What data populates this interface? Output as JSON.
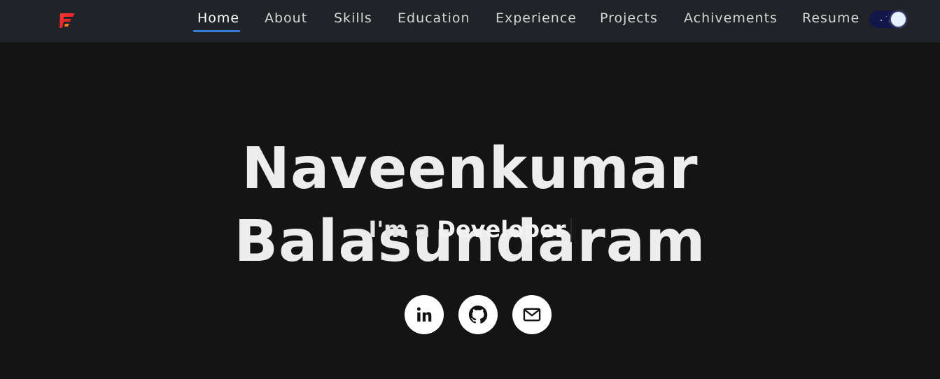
{
  "nav": {
    "logo_icon": "brand-logo-icon",
    "items": [
      {
        "label": "Home",
        "active": true
      },
      {
        "label": "About",
        "active": false
      },
      {
        "label": "Skills",
        "active": false
      },
      {
        "label": "Education",
        "active": false
      },
      {
        "label": "Experience",
        "active": false
      },
      {
        "label": "Projects",
        "active": false
      },
      {
        "label": "Achivements",
        "active": false
      },
      {
        "label": "Resume",
        "active": false
      }
    ],
    "theme_toggle": {
      "state": "dark",
      "icon": "moon-toggle-icon"
    }
  },
  "hero": {
    "name": "Naveenkumar Balasundaram",
    "prefix": "I'm a",
    "typed": "Developer"
  },
  "social": [
    {
      "name": "linkedin",
      "icon": "linkedin-icon"
    },
    {
      "name": "github",
      "icon": "github-icon"
    },
    {
      "name": "email",
      "icon": "mail-icon"
    }
  ],
  "colors": {
    "background": "#141415",
    "navbar": "#202327",
    "accent": "#3a7bd5",
    "text": "#ededed",
    "toggle_bg": "#12164a"
  }
}
